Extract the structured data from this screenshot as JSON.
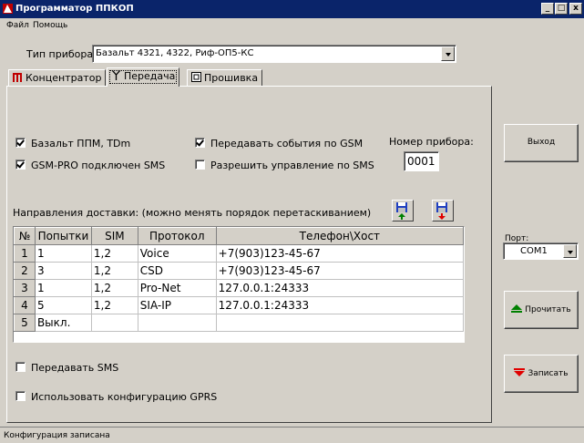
{
  "window": {
    "title": "Программатор ППКОП",
    "buttons": {
      "minimize": "_",
      "maximize": "□",
      "close": "x"
    }
  },
  "menu": [
    "Файл",
    "Помощь"
  ],
  "device": {
    "label": "Тип прибора",
    "value": "Базальт 4321, 4322, Риф-ОП5-КС"
  },
  "tabs": [
    {
      "label": "Концентратор",
      "icon": "bars-icon"
    },
    {
      "label": "Передача",
      "icon": "antenna-icon",
      "active": true
    },
    {
      "label": "Прошивка",
      "icon": "chip-icon"
    }
  ],
  "options": {
    "bazalt_ppm": {
      "label": "Базальт ППМ, TDm",
      "checked": true
    },
    "gsm_pro": {
      "label": "GSM-PRO подключен  SMS",
      "checked": true
    },
    "send_events_gsm": {
      "label": "Передавать события по GSM",
      "checked": true
    },
    "allow_sms_control": {
      "label": "Разрешить управление по SMS",
      "checked": false
    },
    "send_sms": {
      "label": "Передавать SMS",
      "checked": false
    },
    "use_gprs": {
      "label": "Использовать конфигурацию GPRS",
      "checked": false
    }
  },
  "device_number": {
    "label": "Номер прибора:",
    "value": "0001"
  },
  "delivery": {
    "label": "Направления доставки: (можно менять порядок перетаскиванием)",
    "columns": [
      "№",
      "Попытки",
      "SIM",
      "Протокол",
      "Телефон\\Хост"
    ],
    "rows": [
      {
        "num": "1",
        "attempts": "1",
        "sim": "1,2",
        "protocol": "Voice",
        "target": "+7(903)123-45-67"
      },
      {
        "num": "2",
        "attempts": "3",
        "sim": "1,2",
        "protocol": "CSD",
        "target": "+7(903)123-45-67"
      },
      {
        "num": "3",
        "attempts": "1",
        "sim": "1,2",
        "protocol": "Pro-Net",
        "target": "127.0.0.1:24333"
      },
      {
        "num": "4",
        "attempts": "5",
        "sim": "1,2",
        "protocol": "SIA-IP",
        "target": "127.0.0.1:24333"
      },
      {
        "num": "5",
        "attempts": "Выкл.",
        "sim": "",
        "protocol": "",
        "target": ""
      }
    ]
  },
  "right_panel": {
    "exit": "Выход",
    "port_label": "Порт:",
    "port_value": "COM1",
    "read": "Прочитать",
    "write": "Записать"
  },
  "status": "Конфигурация записана",
  "colors": {
    "title_bar": "#0a246a",
    "face": "#d4d0c8",
    "read_icon": "#008000",
    "write_icon": "#e00000"
  }
}
